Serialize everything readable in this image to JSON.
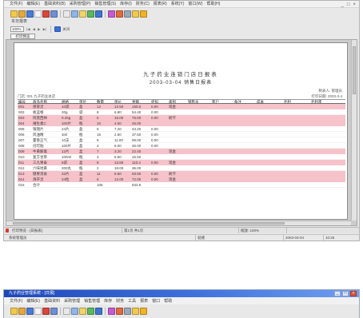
{
  "app": {
    "menu": [
      "文件(F)",
      "编辑(E)",
      "基础资料(B)",
      "采购管理(P)",
      "销售管理(S)",
      "库存(I)",
      "财务(C)",
      "报表(R)",
      "系统(Y)",
      "窗口(W)",
      "帮助(H)"
    ],
    "window_controls": {
      "minimize": "_",
      "maximize": "□",
      "close": "×"
    },
    "toolbar": [
      {
        "icon": "new-file-icon",
        "color": "#f2c94c"
      },
      {
        "icon": "open-folder-icon",
        "color": "#e5a93a"
      },
      {
        "icon": "save-icon",
        "color": "#4b7bd8"
      },
      {
        "icon": "document-icon",
        "color": "#f3f3f3"
      },
      {
        "icon": "delete-icon",
        "color": "#d9473a"
      },
      {
        "icon": "print-icon",
        "color": "#6d8fd6"
      },
      {
        "icon": "preview-icon",
        "color": "#e9e9e9"
      },
      {
        "icon": "find-icon",
        "color": "#8fb6e8"
      },
      {
        "icon": "filter-icon",
        "color": "#f0d36a"
      },
      {
        "icon": "refresh-icon",
        "color": "#5cb85c"
      },
      {
        "icon": "report-icon",
        "color": "#3f74d1"
      },
      {
        "icon": "chart-icon",
        "color": "#c75ad0"
      },
      {
        "icon": "user-icon",
        "color": "#e06b3c"
      },
      {
        "icon": "calculator-icon",
        "color": "#9aa9bd"
      },
      {
        "icon": "help-icon",
        "color": "#f2c94c"
      },
      {
        "icon": "exit-icon",
        "color": "#f0b429"
      }
    ],
    "caption": "本日报表",
    "preview_toolbar": {
      "zoom": "100%",
      "buttons": [
        "|◀",
        "◀",
        "▶",
        "▶|"
      ],
      "print_color": "#3b6fd6",
      "close_label": "关闭"
    },
    "tab_label": "打印预览"
  },
  "report": {
    "title": "九子药业连锁门店日报表",
    "subtitle": "2003-03-04 销售日报表",
    "maker": "制表人: 管理员",
    "print_date": "打印日期: 2003-3-4",
    "store": "门店: 001 九子药业总店",
    "columns": [
      "编号",
      "商品名称",
      "规格",
      "单位",
      "数量",
      "单价",
      "金额",
      "折扣",
      "类别",
      "销售员",
      "客户",
      "备注",
      "成本",
      "毛利",
      "毛利率"
    ],
    "rows": [
      {
        "highlight": true,
        "cells": [
          "001",
          "感冒灵",
          "10袋",
          "盒",
          "12",
          "12.50",
          "150.0",
          "0.00",
          "现金",
          "",
          "",
          "",
          "",
          "",
          ""
        ]
      },
      {
        "highlight": false,
        "cells": [
          "002",
          "板蓝根",
          "20g",
          "袋",
          "8",
          "6.80",
          "54.40",
          "0.00",
          "",
          "",
          "",
          "",
          "",
          "",
          ""
        ]
      },
      {
        "highlight": true,
        "cells": [
          "003",
          "阿莫西林",
          "0.25g",
          "盒",
          "5",
          "15.00",
          "75.00",
          "0.00",
          "刷卡",
          "",
          "",
          "",
          "",
          "",
          ""
        ]
      },
      {
        "highlight": true,
        "cells": [
          "004",
          "维生素C",
          "100片",
          "瓶",
          "10",
          "4.50",
          "45.00",
          "",
          "",
          "",
          "",
          "",
          "",
          "",
          ""
        ]
      },
      {
        "highlight": false,
        "cells": [
          "005",
          "银翘片",
          "24片",
          "盒",
          "6",
          "7.20",
          "43.20",
          "0.00",
          "",
          "",
          "",
          "",
          "",
          "",
          ""
        ]
      },
      {
        "highlight": false,
        "cells": [
          "006",
          "风油精",
          "3ml",
          "瓶",
          "15",
          "2.50",
          "37.50",
          "0.00",
          "",
          "",
          "",
          "",
          "",
          "",
          ""
        ]
      },
      {
        "highlight": false,
        "cells": [
          "007",
          "藿香正气",
          "10支",
          "盒",
          "9",
          "11.00",
          "99.00",
          "0.00",
          "",
          "",
          "",
          "",
          "",
          "",
          ""
        ]
      },
      {
        "highlight": false,
        "cells": [
          "008",
          "创可贴",
          "100片",
          "盒",
          "4",
          "9.00",
          "36.00",
          "0.00",
          "",
          "",
          "",
          "",
          "",
          "",
          ""
        ]
      },
      {
        "highlight": true,
        "cells": [
          "009",
          "牛黄解毒",
          "12片",
          "盒",
          "7",
          "3.20",
          "22.40",
          "",
          "现金",
          "",
          "",
          "",
          "",
          "",
          ""
        ]
      },
      {
        "highlight": false,
        "cells": [
          "010",
          "复方甘草",
          "100ml",
          "瓶",
          "3",
          "5.50",
          "16.50",
          "",
          "",
          "",
          "",
          "",
          "",
          "",
          ""
        ]
      },
      {
        "highlight": true,
        "cells": [
          "011",
          "三九胃泰",
          "6袋",
          "盒",
          "8",
          "13.80",
          "110.4",
          "0.00",
          "现金",
          "",
          "",
          "",
          "",
          "",
          ""
        ]
      },
      {
        "highlight": false,
        "cells": [
          "012",
          "六味地黄",
          "200丸",
          "瓶",
          "2",
          "18.00",
          "36.00",
          "",
          "",
          "",
          "",
          "",
          "",
          "",
          ""
        ]
      },
      {
        "highlight": true,
        "cells": [
          "013",
          "健胃消食",
          "32片",
          "盒",
          "11",
          "8.50",
          "93.50",
          "0.00",
          "刷卡",
          "",
          "",
          "",
          "",
          "",
          ""
        ]
      },
      {
        "highlight": true,
        "cells": [
          "014",
          "清开灵",
          "24粒",
          "盒",
          "6",
          "12.00",
          "72.00",
          "0.00",
          "现金",
          "",
          "",
          "",
          "",
          "",
          ""
        ]
      },
      {
        "highlight": false,
        "cells": [
          "015",
          "合计",
          "",
          "",
          "106",
          "",
          "933.9",
          "",
          "",
          "",
          "",
          "",
          "",
          "",
          ""
        ]
      }
    ]
  },
  "status_bar": {
    "document": "打印预览 - [日报表]",
    "page": "第1页 共1页",
    "zoom": "缩放: 100%",
    "extra": ""
  },
  "footer_bar": {
    "user": "系统管理员",
    "state": "就绪",
    "date": "2003-03-04",
    "time": "10:25"
  },
  "app2": {
    "title": "九子药业管理系统 - [日报]",
    "window_controls": {
      "minimize": "_",
      "maximize": "□",
      "close": "×"
    },
    "menu": [
      "文件(F)",
      "编辑(E)",
      "基础资料",
      "采购管理",
      "销售管理",
      "库存",
      "财务",
      "工具",
      "报表",
      "窗口",
      "帮助"
    ],
    "toolbar": [
      {
        "icon": "new-file-icon",
        "color": "#f2c94c"
      },
      {
        "icon": "open-folder-icon",
        "color": "#e5a93a"
      },
      {
        "icon": "save-icon",
        "color": "#4b7bd8"
      },
      {
        "icon": "document-icon",
        "color": "#f3f3f3"
      },
      {
        "icon": "delete-icon",
        "color": "#d9473a"
      },
      {
        "icon": "print-icon",
        "color": "#6d8fd6"
      },
      {
        "icon": "preview-icon",
        "color": "#e9e9e9"
      },
      {
        "icon": "find-icon",
        "color": "#8fb6e8"
      },
      {
        "icon": "filter-icon",
        "color": "#f0d36a"
      },
      {
        "icon": "refresh-icon",
        "color": "#5cb85c"
      },
      {
        "icon": "report-icon",
        "color": "#3f74d1"
      },
      {
        "icon": "chart-icon",
        "color": "#c75ad0"
      },
      {
        "icon": "user-icon",
        "color": "#e06b3c"
      },
      {
        "icon": "calculator-icon",
        "color": "#9aa9bd"
      },
      {
        "icon": "help-icon",
        "color": "#f2c94c"
      },
      {
        "icon": "exit-icon",
        "color": "#f0b429"
      }
    ]
  }
}
